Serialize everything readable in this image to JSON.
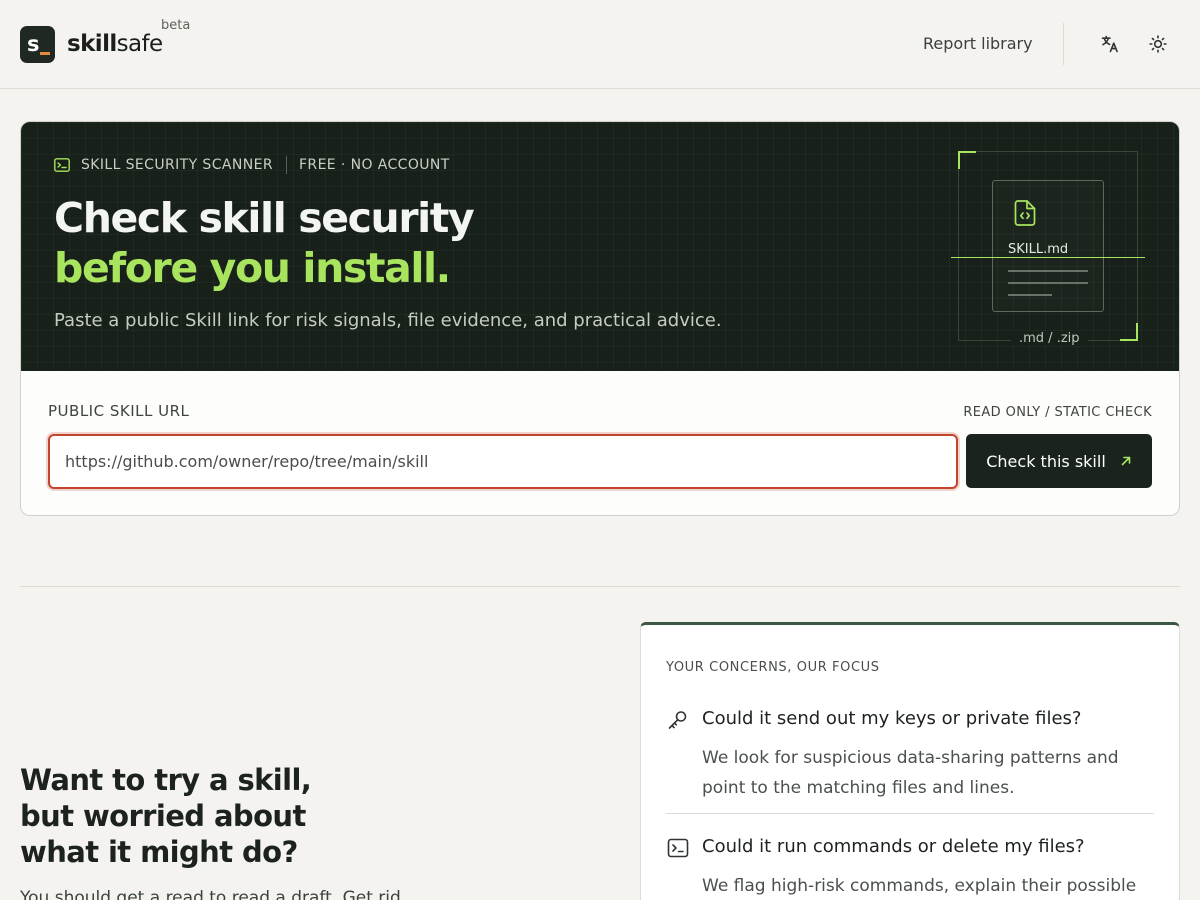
{
  "header": {
    "logo_mark": "s",
    "brand_bold": "skill",
    "brand_light": "safe",
    "beta": "beta",
    "nav_report_library": "Report library",
    "icons": [
      "translate-icon",
      "sun-icon"
    ]
  },
  "hero": {
    "eyebrow_primary": "SKILL SECURITY SCANNER",
    "eyebrow_secondary": "FREE · NO ACCOUNT",
    "title_line1": "Check skill security",
    "title_line2": "before you install.",
    "subtitle": "Paste a public Skill link for risk signals, file evidence, and practical advice.",
    "illustration_file": "SKILL.md",
    "illustration_caption": ".md / .zip"
  },
  "form": {
    "label": "PUBLIC SKILL URL",
    "meta": "READ ONLY / STATIC CHECK",
    "url_placeholder": "https://github.com/owner/repo/tree/main/skill",
    "url_value": "",
    "submit_label": "Check this skill"
  },
  "lower": {
    "title": "Want to try a skill, but worried about what it might do?",
    "body": "You should get a read to read a draft. Get rid"
  },
  "concerns": {
    "label": "YOUR CONCERNS, OUR FOCUS",
    "items": [
      {
        "icon": "key-icon",
        "title": "Could it send out my keys or private files?",
        "description": "We look for suspicious data-sharing patterns and point to the matching files and lines."
      },
      {
        "icon": "terminal-icon",
        "title": "Could it run commands or delete my files?",
        "description": "We flag high-risk commands, explain their possible"
      }
    ]
  },
  "colors": {
    "accent": "#a8e45e",
    "hero_bg": "#172019",
    "button_bg": "#1a241d",
    "error_border": "#c4452f",
    "page_bg": "#f4f3ef"
  }
}
